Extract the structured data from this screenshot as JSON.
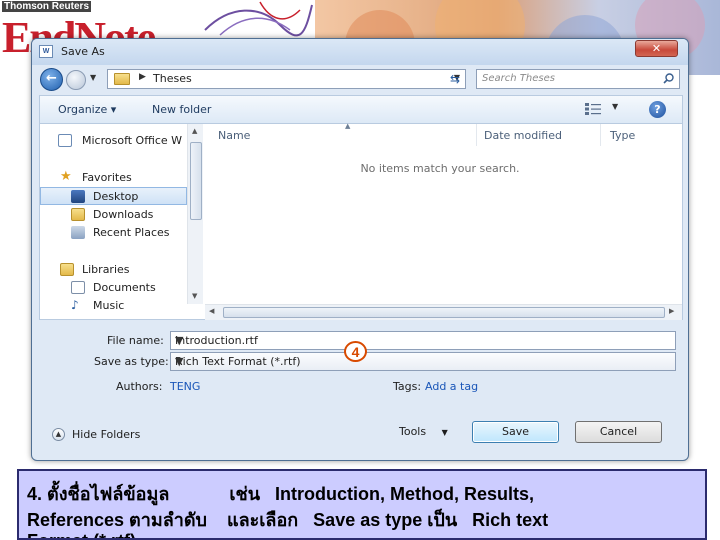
{
  "banner": {
    "company": "Thomson Reuters",
    "logo_text": "EndNote"
  },
  "dialog": {
    "title": "Save As",
    "close_label": "✕",
    "address": {
      "breadcrumb": "Theses",
      "search_placeholder": "Search Theses"
    },
    "toolbar": {
      "organize_label": "Organize ▾",
      "new_folder_label": "New folder",
      "help_label": "?"
    },
    "nav_items": [
      {
        "label": "Microsoft Office W",
        "icon": "word-icon"
      },
      {
        "label": "Favorites",
        "icon": "star-icon"
      },
      {
        "label": "Desktop",
        "icon": "desktop-icon",
        "selected": true
      },
      {
        "label": "Downloads",
        "icon": "downloads-icon"
      },
      {
        "label": "Recent Places",
        "icon": "recent-places-icon"
      },
      {
        "label": "Libraries",
        "icon": "libraries-icon"
      },
      {
        "label": "Documents",
        "icon": "documents-icon"
      },
      {
        "label": "Music",
        "icon": "music-icon"
      }
    ],
    "columns": [
      "Name",
      "Date modified",
      "Type"
    ],
    "empty_message": "No items match your search.",
    "form": {
      "filename_label": "File name:",
      "filename_value": "Introduction.rtf",
      "savetype_label": "Save as type:",
      "savetype_value": "Rich Text Format (*.rtf)",
      "authors_label": "Authors:",
      "authors_value": "TENG",
      "tags_label": "Tags:",
      "tags_value": "Add a tag"
    },
    "footer": {
      "hide_folders_label": "Hide Folders",
      "tools_label": "Tools",
      "save_label": "Save",
      "cancel_label": "Cancel"
    },
    "step_marker": "4"
  },
  "caption": {
    "line1": "4. ตั้งชื่อไฟล์ข้อมูล            เช่น   Introduction, Method, Results,",
    "line2": "References ตามลำดับ    และเลือก   Save as type เป็น   Rich text",
    "line3": "Format (*.rtf)"
  }
}
